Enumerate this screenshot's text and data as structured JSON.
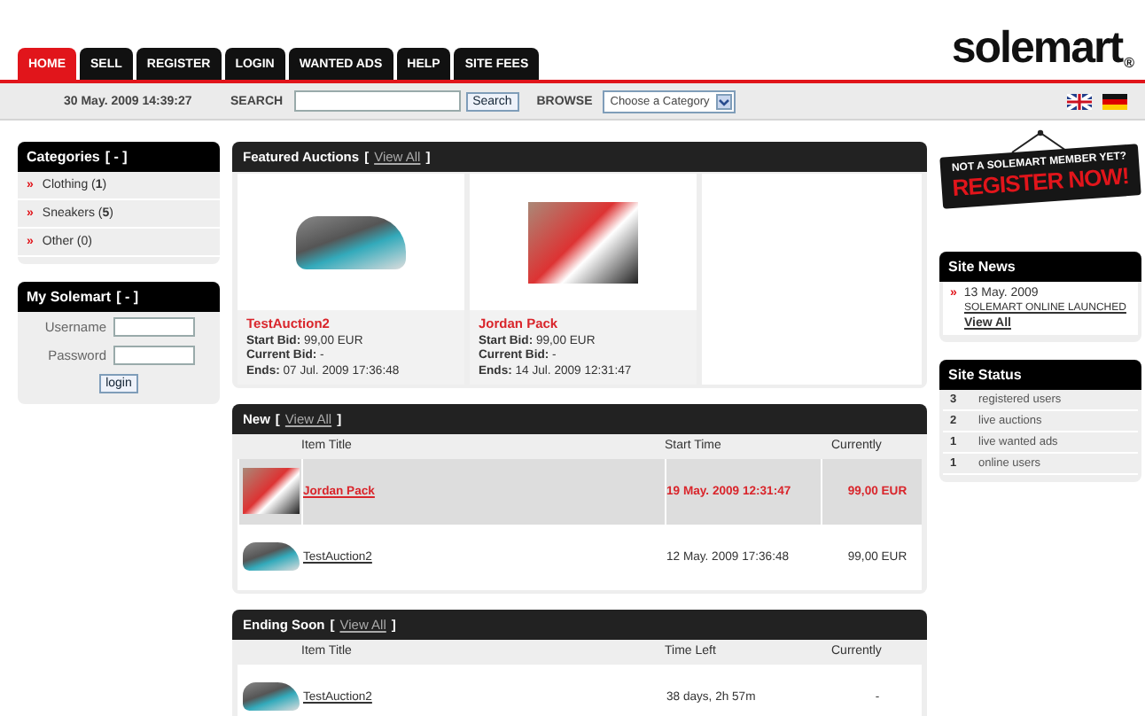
{
  "tabs": [
    {
      "label": "HOME",
      "selected": true
    },
    {
      "label": "SELL",
      "selected": false
    },
    {
      "label": "REGISTER",
      "selected": false
    },
    {
      "label": "LOGIN",
      "selected": false
    },
    {
      "label": "WANTED ADS",
      "selected": false
    },
    {
      "label": "HELP",
      "selected": false
    },
    {
      "label": "SITE FEES",
      "selected": false
    }
  ],
  "logo": {
    "text": "solemart",
    "mark": "®"
  },
  "toolbar": {
    "datetime": "30 May. 2009 14:39:27",
    "search_label": "SEARCH",
    "search_button": "Search",
    "browse_label": "BROWSE",
    "browse_value": "Choose a Category"
  },
  "categories": {
    "title": "Categories",
    "toggle": "[ - ]",
    "items": [
      {
        "bullet": "»",
        "label": "Clothing (**1**)"
      },
      {
        "bullet": "»",
        "label": "Sneakers (**5**)"
      },
      {
        "bullet": "»",
        "label": "Other (0)"
      }
    ]
  },
  "my_solemart": {
    "title": "My Solemart",
    "toggle": "[ - ]",
    "username_label": "Username",
    "password_label": "Password",
    "login_button": "login"
  },
  "featured": {
    "title": "Featured Auctions",
    "open": "[",
    "view_all": "View All",
    "close": "]",
    "items": [
      {
        "name": "TestAuction2",
        "kind": "shoe",
        "start_label": "Start Bid:",
        "start": "99,00 EUR",
        "current_label": "Current Bid:",
        "current": "-",
        "ends_label": "Ends:",
        "ends": "07 Jul. 2009 17:36:48"
      },
      {
        "name": "Jordan Pack",
        "kind": "box",
        "start_label": "Start Bid:",
        "start": "99,00 EUR",
        "current_label": "Current Bid:",
        "current": "-",
        "ends_label": "Ends:",
        "ends": "14 Jul. 2009 12:31:47"
      }
    ]
  },
  "new": {
    "title": "New",
    "open": "[",
    "view_all": "View All",
    "close": "]",
    "columns": [
      "Item Title",
      "Start Time",
      "Currently"
    ],
    "rows": [
      {
        "kind": "box",
        "title": "Jordan Pack",
        "time": "19 May. 2009 12:31:47",
        "price": "99,00 EUR",
        "highlighted": true
      },
      {
        "kind": "shoe",
        "title": "TestAuction2",
        "time": "12 May. 2009 17:36:48",
        "price": "99,00 EUR",
        "highlighted": false
      }
    ]
  },
  "ending_soon": {
    "title": "Ending Soon",
    "open": "[",
    "view_all": "View All",
    "close": "]",
    "columns": [
      "Item Title",
      "Time Left",
      "Currently"
    ],
    "rows": [
      {
        "kind": "shoe",
        "title": "TestAuction2",
        "time": "38 days, 2h 57m",
        "price": "-",
        "highlighted": false
      }
    ]
  },
  "register_banner": {
    "line1": "NOT A SOLEMART MEMBER YET?",
    "line2": "REGISTER NOW!"
  },
  "site_news": {
    "title": "Site News",
    "bullet": "»",
    "date": "13 May. 2009",
    "headline": "SOLEMART ONLINE LAUNCHED",
    "view_all": "View All"
  },
  "site_status": {
    "title": "Site Status",
    "rows": [
      {
        "count": "3",
        "label": "registered users"
      },
      {
        "count": "2",
        "label": "live auctions"
      },
      {
        "count": "1",
        "label": "live wanted ads"
      },
      {
        "count": "1",
        "label": "online users"
      }
    ]
  }
}
